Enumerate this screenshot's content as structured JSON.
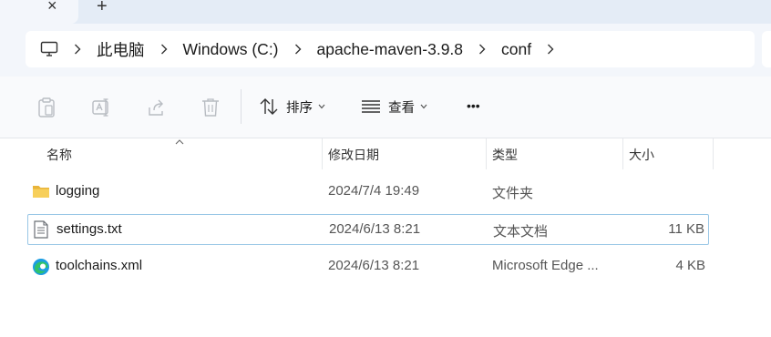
{
  "tabs": {
    "close_symbol": "×",
    "new_tab_symbol": "+"
  },
  "breadcrumb": {
    "root_icon": "computer-icon",
    "items": [
      "此电脑",
      "Windows (C:)",
      "apache-maven-3.9.8",
      "conf"
    ]
  },
  "toolbar": {
    "sort_label": "排序",
    "view_label": "查看",
    "more_label": "•••"
  },
  "columns": {
    "name": "名称",
    "date": "修改日期",
    "type": "类型",
    "size": "大小"
  },
  "files": [
    {
      "icon": "folder-icon",
      "name": "logging",
      "date": "2024/7/4 19:49",
      "type": "文件夹",
      "size": ""
    },
    {
      "icon": "text-file-icon",
      "name": "settings.txt",
      "date": "2024/6/13 8:21",
      "type": "文本文档",
      "size": "11 KB"
    },
    {
      "icon": "edge-icon",
      "name": "toolchains.xml",
      "date": "2024/6/13 8:21",
      "type": "Microsoft Edge ...",
      "size": "4 KB"
    }
  ],
  "colors": {
    "folder": "#f5c544",
    "selection_border": "#99c7e6",
    "tabstrip": "#e4ecf6"
  }
}
